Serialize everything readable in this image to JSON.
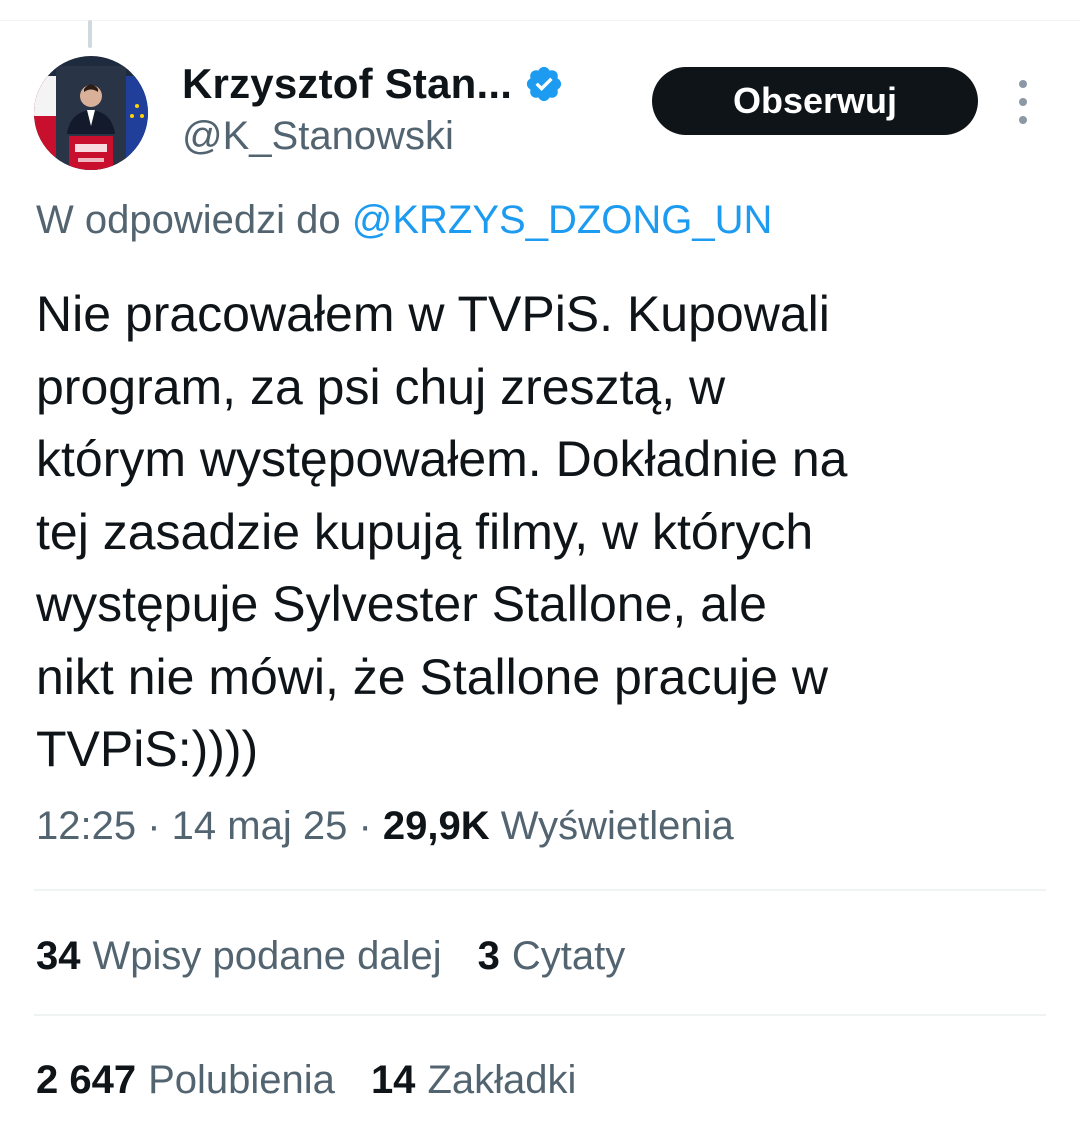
{
  "author": {
    "display_name": "Krzysztof Stan...",
    "handle": "@K_Stanowski",
    "avatar": "profile-photo",
    "verified_icon": "verified-badge-icon"
  },
  "follow_button_label": "Obserwuj",
  "more_icon": "more-vertical-icon",
  "reply": {
    "prefix": "W odpowiedzi do ",
    "mention": "@KRZYS_DZONG_UN"
  },
  "tweet_lines": [
    "Nie pracowałem w TVPiS. Kupowali",
    "program, za psi chuj zresztą, w",
    "którym występowałem. Dokładnie na",
    "tej zasadzie kupują filmy, w których",
    "występuje Sylvester Stallone, ale",
    "nikt nie mówi, że Stallone pracuje w",
    "TVPiS:))))"
  ],
  "meta": {
    "time": "12:25",
    "separator": " · ",
    "date": "14 maj 25",
    "views_count": "29,9K",
    "views_label": " Wyświetlenia"
  },
  "stats_row1": [
    {
      "count": "34",
      "label": "Wpisy podane dalej"
    },
    {
      "count": "3",
      "label": "Cytaty"
    }
  ],
  "stats_row2": [
    {
      "count": "2 647",
      "label": "Polubienia"
    },
    {
      "count": "14",
      "label": "Zakładki"
    }
  ],
  "colors": {
    "text_primary": "#0f1419",
    "text_secondary": "#536471",
    "link_blue": "#1d9bf0",
    "button_bg": "#0f1419"
  }
}
